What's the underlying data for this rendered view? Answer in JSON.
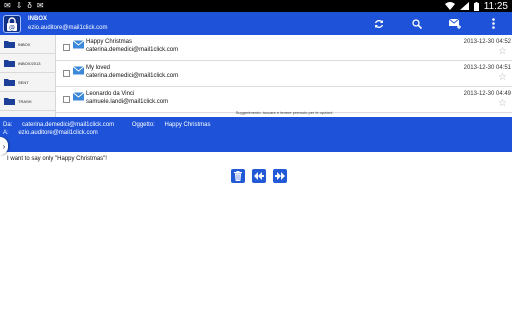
{
  "statusbar": {
    "notifications": [
      "✉",
      "⇩",
      "δ",
      "✉"
    ],
    "time": "11:25"
  },
  "app": {
    "title": "INBOX",
    "account": "ezio.auditore@mail1click.com"
  },
  "folders": [
    {
      "label": "INBOX"
    },
    {
      "label": "INBOX/2013"
    },
    {
      "label": "SENT"
    },
    {
      "label": "TRASH"
    }
  ],
  "messages": [
    {
      "subject": "Happy Christmas",
      "sender": "caterina.demedici@mail1click.com",
      "date": "2013-12-30 04:52"
    },
    {
      "subject": "My loved",
      "sender": "caterina.demedici@mail1click.com",
      "date": "2013-12-30 04:51"
    },
    {
      "subject": "Leonardo da Vinci",
      "sender": "samuele.landi@mail1click.com",
      "date": "2013-12-30 04:49"
    }
  ],
  "list_hint": "Suggerimento: toccare e tenere premuto per le opzioni",
  "preview": {
    "from_label": "Da:",
    "from": "caterina.demedici@mail1click.com",
    "subject_label": "Oggetto:",
    "subject": "Happy Christmas",
    "to_label": "A:",
    "to": "ezio.auditore@mail1click.com",
    "body": "I want to say only \"Happy Christmas\"!"
  },
  "colors": {
    "accent": "#1e53d9",
    "button": "#2159d6"
  }
}
